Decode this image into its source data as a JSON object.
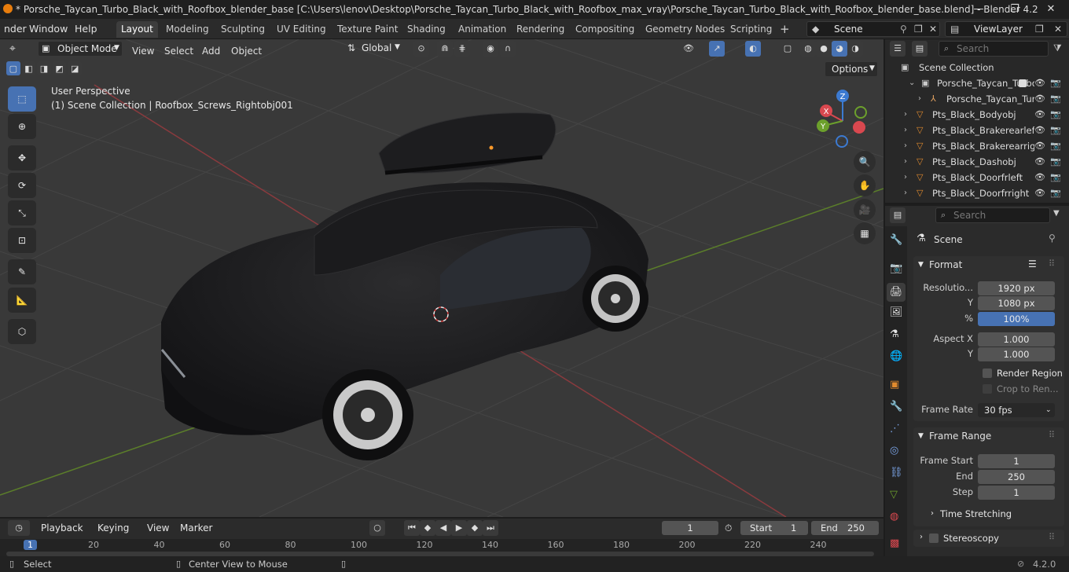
{
  "window": {
    "title": "* Porsche_Taycan_Turbo_Black_with_Roofbox_blender_base [C:\\Users\\lenov\\Desktop\\Porsche_Taycan_Turbo_Black_with_Roofbox_max_vray\\Porsche_Taycan_Turbo_Black_with_Roofbox_blender_base.blend] - Blender 4.2",
    "minimize": "—",
    "maximize": "❐",
    "close": "✕"
  },
  "menubar": {
    "items": [
      "nder",
      "Window",
      "Help"
    ],
    "workspaces": [
      "Layout",
      "Modeling",
      "Sculpting",
      "UV Editing",
      "Texture Paint",
      "Shading",
      "Animation",
      "Rendering",
      "Compositing",
      "Geometry Nodes",
      "Scripting"
    ],
    "active_workspace": "Layout",
    "add_workspace": "+",
    "scene": "Scene",
    "view_layer": "ViewLayer"
  },
  "viewport_header": {
    "mode": "Object Mode",
    "menus": [
      "View",
      "Select",
      "Add",
      "Object"
    ],
    "orientation": "Global",
    "options": "Options"
  },
  "viewport": {
    "perspective": "User Perspective",
    "context": "(1) Scene Collection | Roofbox_Screws_Rightobj001",
    "gizmo_axes": {
      "x": "X",
      "y": "Y",
      "z": "Z"
    }
  },
  "outliner": {
    "search_placeholder": "Search",
    "root": "Scene Collection",
    "items": [
      {
        "label": "Porsche_Taycan_Turbo_Black_with_Roofbox",
        "level": 1,
        "icon": "collection-icon"
      },
      {
        "label": "Porsche_Taycan_Turbo",
        "level": 2,
        "icon": "armature-icon"
      },
      {
        "label": "Pts_Black_Bodyobj",
        "level": 1,
        "icon": "mesh-icon"
      },
      {
        "label": "Pts_Black_Brakerearleft",
        "level": 1,
        "icon": "mesh-icon"
      },
      {
        "label": "Pts_Black_Brakerearright",
        "level": 1,
        "icon": "mesh-icon"
      },
      {
        "label": "Pts_Black_Dashobj",
        "level": 1,
        "icon": "mesh-icon"
      },
      {
        "label": "Pts_Black_Doorfrleft",
        "level": 1,
        "icon": "mesh-icon"
      },
      {
        "label": "Pts_Black_Doorfrright",
        "level": 1,
        "icon": "mesh-icon"
      }
    ]
  },
  "properties": {
    "search_placeholder": "Search",
    "context": "Scene",
    "format": {
      "title": "Format",
      "resolution_x_label": "Resolutio...",
      "resolution_x": "1920 px",
      "resolution_y_label": "Y",
      "resolution_y": "1080 px",
      "percent_label": "%",
      "percent": "100%",
      "aspect_x_label": "Aspect X",
      "aspect_x": "1.000",
      "aspect_y_label": "Y",
      "aspect_y": "1.000",
      "render_region": "Render Region",
      "crop": "Crop to Ren...",
      "frame_rate_label": "Frame Rate",
      "frame_rate": "30 fps"
    },
    "frame_range": {
      "title": "Frame Range",
      "start_label": "Frame Start",
      "start": "1",
      "end_label": "End",
      "end": "250",
      "step_label": "Step",
      "step": "1",
      "time_stretching": "Time Stretching"
    },
    "stereoscopy": "Stereoscopy"
  },
  "timeline": {
    "menus": [
      "Playback",
      "Keying",
      "View",
      "Marker"
    ],
    "current_frame": "1",
    "start_label": "Start",
    "start": "1",
    "end_label": "End",
    "end": "250",
    "ruler": [
      "1",
      "20",
      "40",
      "60",
      "80",
      "100",
      "120",
      "140",
      "160",
      "180",
      "200",
      "220",
      "240"
    ]
  },
  "statusbar": {
    "select": "Select",
    "center_view": "Center View to Mouse",
    "version": "4.2.0"
  },
  "colors": {
    "accent": "#4772b3",
    "x_axis": "#d9484f",
    "y_axis": "#6ca02c",
    "z_axis": "#3c7ad1"
  }
}
